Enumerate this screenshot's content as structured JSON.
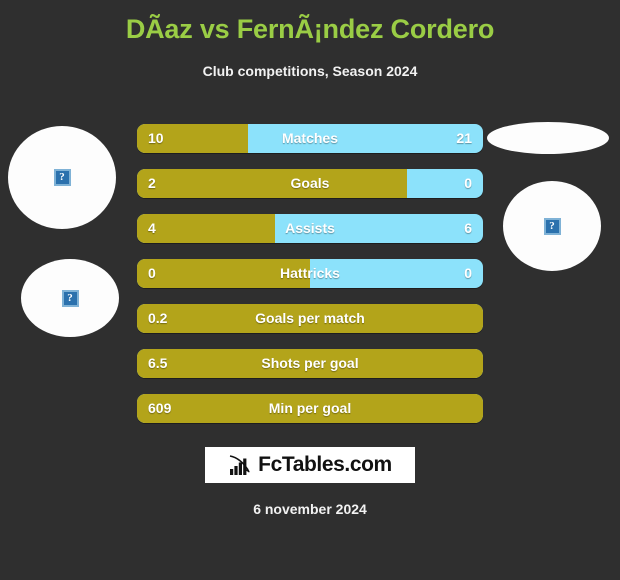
{
  "header": {
    "title": "DÃ­az vs FernÃ¡ndez Cordero",
    "subtitle": "Club competitions, Season 2024"
  },
  "footer": {
    "date": "6 november 2024"
  },
  "logo": {
    "text": "FcTables.com",
    "icon": "bar-chart-growth-icon"
  },
  "avatars": {
    "placeholder_glyph": "?",
    "home_label": "",
    "away_label": ""
  },
  "colors": {
    "background": "#2f2f2f",
    "title": "#9acd45",
    "home_bar": "#b3a41a",
    "away_bar": "#8ce2fb",
    "text": "#ffffff",
    "logo_background": "#ffffff"
  },
  "chart_data": {
    "type": "bar",
    "title": "DÃ­az vs FernÃ¡ndez Cordero",
    "subtitle": "Club competitions, Season 2024",
    "orientation": "horizontal-diverging",
    "legend": [
      "DÃ­az",
      "FernÃ¡ndez Cordero"
    ],
    "categories": [
      "Matches",
      "Goals",
      "Assists",
      "Hattricks",
      "Goals per match",
      "Shots per goal",
      "Min per goal"
    ],
    "series": [
      {
        "name": "DÃ­az",
        "color": "#b3a41a",
        "values": [
          "10",
          "2",
          "4",
          "0",
          "0.2",
          "6.5",
          "609"
        ]
      },
      {
        "name": "FernÃ¡ndez Cordero",
        "color": "#8ce2fb",
        "values": [
          "21",
          "0",
          "6",
          "0",
          "",
          "",
          ""
        ]
      }
    ],
    "rows": [
      {
        "label": "Matches",
        "left": "10",
        "right": "21",
        "left_pct": 32,
        "show_right": true
      },
      {
        "label": "Goals",
        "left": "2",
        "right": "0",
        "left_pct": 78,
        "show_right": true
      },
      {
        "label": "Assists",
        "left": "4",
        "right": "6",
        "left_pct": 40,
        "show_right": true
      },
      {
        "label": "Hattricks",
        "left": "0",
        "right": "0",
        "left_pct": 50,
        "show_right": true
      },
      {
        "label": "Goals per match",
        "left": "0.2",
        "right": "",
        "left_pct": 100,
        "show_right": false
      },
      {
        "label": "Shots per goal",
        "left": "6.5",
        "right": "",
        "left_pct": 100,
        "show_right": false
      },
      {
        "label": "Min per goal",
        "left": "609",
        "right": "",
        "left_pct": 100,
        "show_right": false
      }
    ]
  }
}
